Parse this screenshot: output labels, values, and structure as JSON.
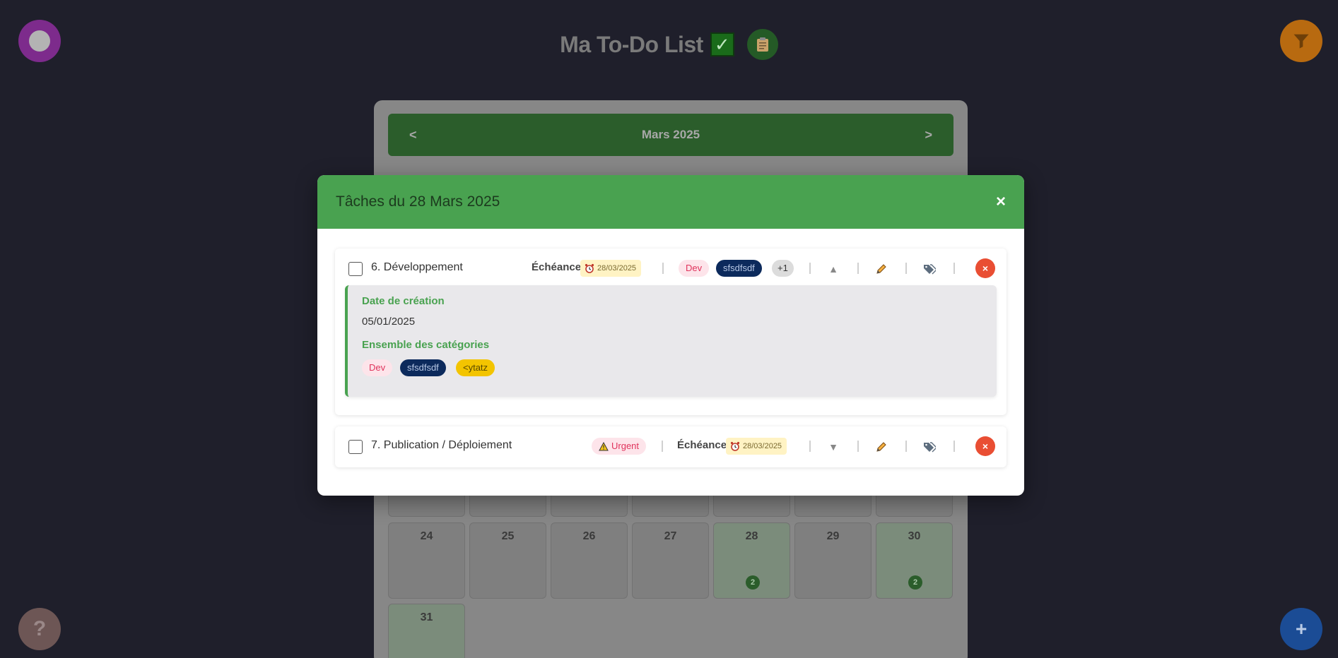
{
  "app": {
    "title": "Ma To-Do List",
    "check_glyph": "✓",
    "clipboard_icon": "clipboard-icon",
    "help_label": "?",
    "add_label": "+"
  },
  "calendar": {
    "month_label": "Mars 2025",
    "prev_label": "<",
    "next_label": ">",
    "days": [
      {
        "num": "24",
        "count": ""
      },
      {
        "num": "25",
        "count": ""
      },
      {
        "num": "26",
        "count": ""
      },
      {
        "num": "27",
        "count": ""
      },
      {
        "num": "28",
        "count": "2"
      },
      {
        "num": "29",
        "count": ""
      },
      {
        "num": "30",
        "count": "2"
      },
      {
        "num": "31",
        "count": ""
      }
    ]
  },
  "modal": {
    "title": "Tâches du 28 Mars 2025",
    "close_label": "×",
    "tasks": [
      {
        "name": "6. Développement",
        "due_label": "Échéance:",
        "due_date": "28/03/2025",
        "tags": [
          "Dev",
          "sfsdfsdf",
          "+1"
        ],
        "arrow": "▲",
        "details": {
          "created_label": "Date de création",
          "created_value": "05/01/2025",
          "categories_label": "Ensemble des catégories",
          "categories": [
            "Dev",
            "sfsdfsdf",
            "<ytatz"
          ]
        }
      },
      {
        "name": "7. Publication / Déploiement",
        "priority": "Urgent",
        "due_label": "Échéance:",
        "due_date": "28/03/2025",
        "arrow": "▼"
      }
    ],
    "delete_label": "×"
  },
  "colors": {
    "accent": "#49a250",
    "delete": "#e94e33",
    "due_bg": "#fff3c4",
    "tag_dev_bg": "#fde4ea",
    "tag_sfsdfsdf_bg": "#0c2a5c",
    "tag_ytatz_bg": "#f3c400"
  }
}
